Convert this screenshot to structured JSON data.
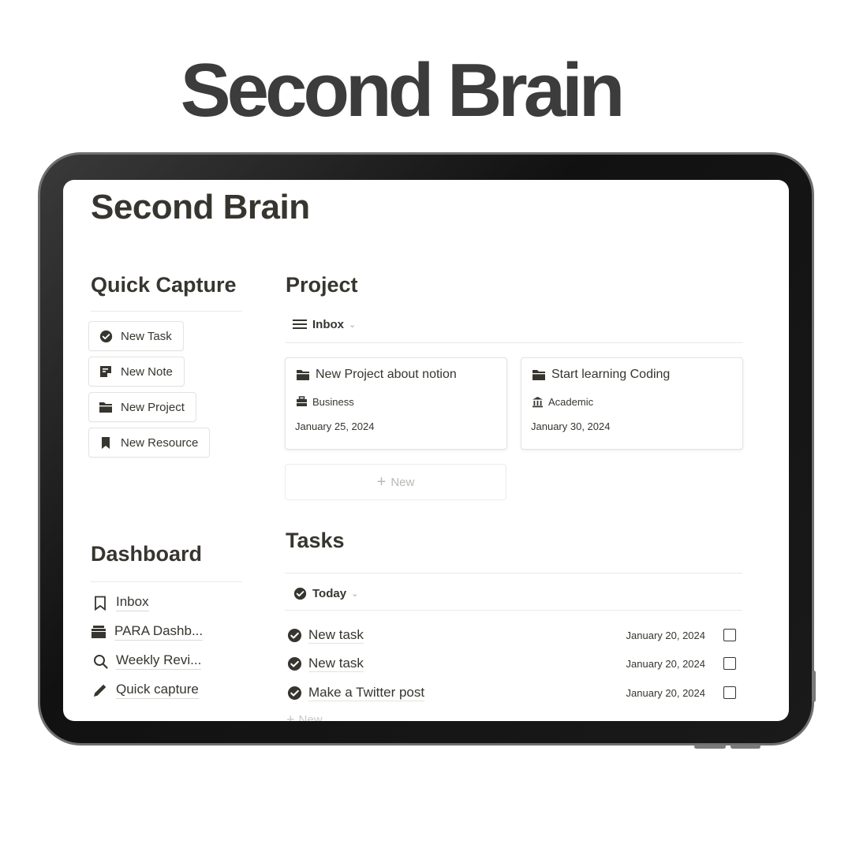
{
  "hero": {
    "title": "Second Brain"
  },
  "page": {
    "title": "Second Brain"
  },
  "quick_capture": {
    "heading": "Quick Capture",
    "buttons": [
      {
        "label": "New Task",
        "icon": "check-circle-icon"
      },
      {
        "label": "New Note",
        "icon": "note-icon"
      },
      {
        "label": "New Project",
        "icon": "folder-icon"
      },
      {
        "label": "New Resource",
        "icon": "bookmark-icon"
      }
    ]
  },
  "dashboard": {
    "heading": "Dashboard",
    "items": [
      {
        "label": "Inbox",
        "icon": "bookmark-outline-icon"
      },
      {
        "label": "PARA Dashb...",
        "icon": "archive-icon"
      },
      {
        "label": "Weekly Revi...",
        "icon": "search-icon"
      },
      {
        "label": "Quick capture",
        "icon": "pencil-icon"
      }
    ]
  },
  "project": {
    "heading": "Project",
    "view": {
      "label": "Inbox",
      "icon": "list-icon"
    },
    "cards": [
      {
        "title": "New Project about notion",
        "tag": "Business",
        "tag_icon": "briefcase-icon",
        "date": "January 25, 2024"
      },
      {
        "title": "Start learning Coding",
        "tag": "Academic",
        "tag_icon": "bank-icon",
        "date": "January 30, 2024"
      }
    ],
    "new_label": "New"
  },
  "tasks": {
    "heading": "Tasks",
    "view": {
      "label": "Today",
      "icon": "check-circle-icon"
    },
    "rows": [
      {
        "name": "New task",
        "date": "January 20, 2024",
        "done": false
      },
      {
        "name": "New task",
        "date": "January 20, 2024",
        "done": false
      },
      {
        "name": "Make a Twitter post",
        "date": "January 20, 2024",
        "done": false
      }
    ],
    "new_label": "New"
  },
  "colors": {
    "text": "#37352f",
    "hero": "#3c3c3c",
    "frame": "#111111",
    "border": "#e3e3e1"
  }
}
